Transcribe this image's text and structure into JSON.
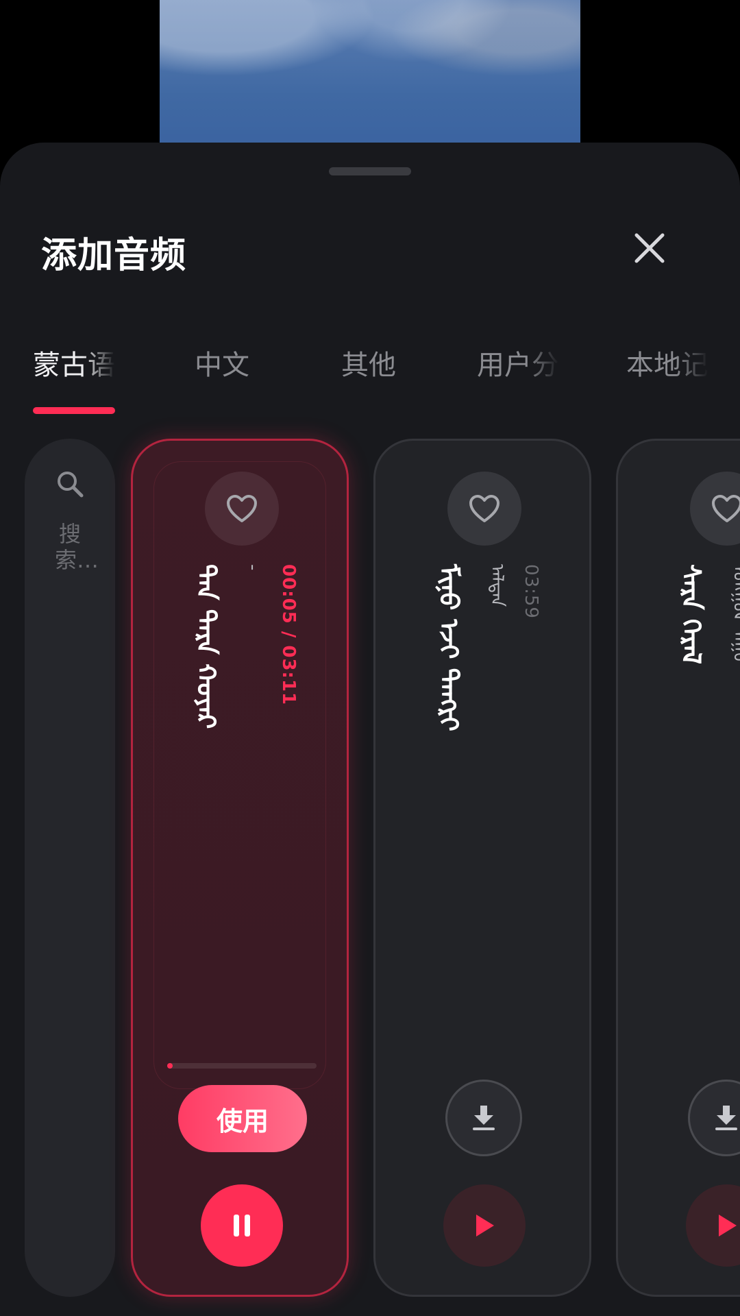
{
  "sheet": {
    "title": "添加音频"
  },
  "tabs": [
    {
      "label": "蒙古语",
      "active": true
    },
    {
      "label": "中文",
      "active": false
    },
    {
      "label": "其他",
      "active": false
    },
    {
      "label": "用户分",
      "active": false
    },
    {
      "label": "本地记",
      "active": false
    }
  ],
  "search": {
    "placeholder": "搜索…"
  },
  "cards": [
    {
      "title": "ᠲᠠᠨ ᠲᠡᠷᠡ ᠬᠣᠶᠠᠷ",
      "artist": "-",
      "time": "00:05 / 03:11",
      "state": "playing",
      "progress": 0.03,
      "use_label": "使用"
    },
    {
      "title": "ᠮᠢᠨᠦ ᠡᠵᠢ ᠲᠡᠨᠭᠷᠢ",
      "artist": "ᠠᠯᠲᠠᠨ",
      "time": "03:59",
      "state": "idle"
    },
    {
      "title": "ᠰᠠᠷᠠ ᠭᠡᠷᠡᠯ",
      "artist": "ᠮᠣᠩᠭᠣᠯ ᠳᠠᠭᠤ",
      "time": "",
      "state": "idle"
    }
  ],
  "colors": {
    "accent": "#ff2d55",
    "sheet_bg": "#18191d",
    "card_bg": "#222327"
  }
}
